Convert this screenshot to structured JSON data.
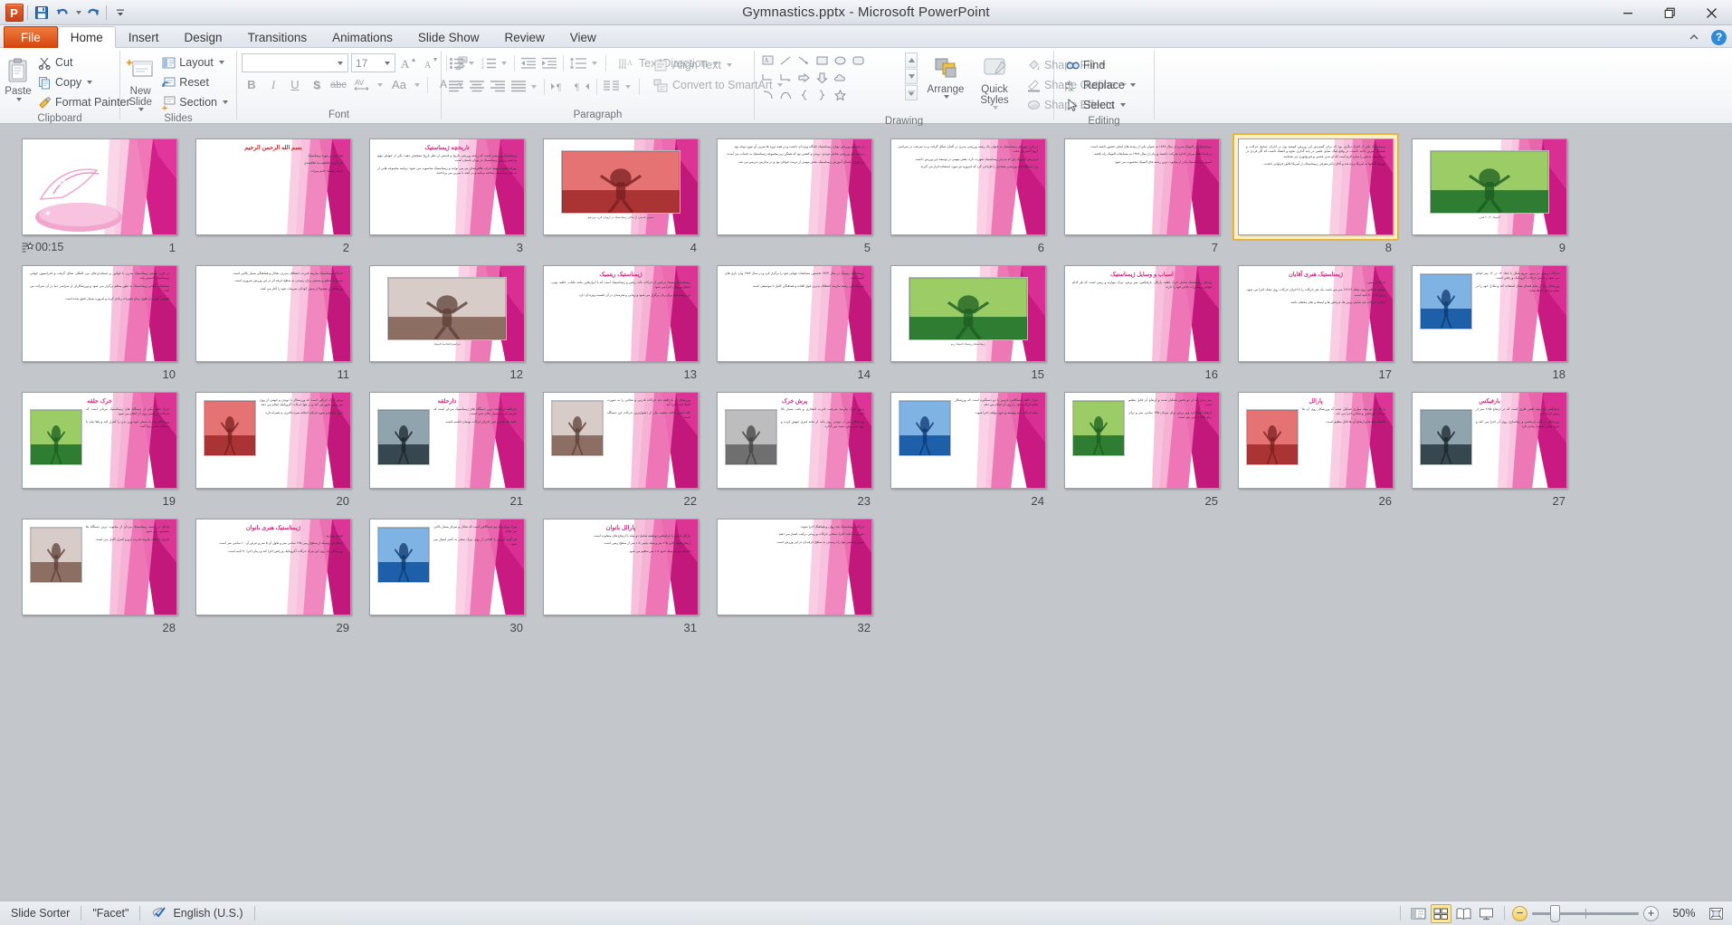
{
  "window": {
    "title": "Gymnastics.pptx  -  Microsoft PowerPoint",
    "minimize": "Minimize",
    "restore": "Restore Down",
    "close": "Close",
    "qat": [
      "save-icon",
      "undo-icon",
      "redo-icon",
      "customize-qat-icon"
    ]
  },
  "tabs": [
    {
      "label": "File",
      "kind": "file"
    },
    {
      "label": "Home",
      "kind": "active"
    },
    {
      "label": "Insert",
      "kind": "normal"
    },
    {
      "label": "Design",
      "kind": "normal"
    },
    {
      "label": "Transitions",
      "kind": "normal"
    },
    {
      "label": "Animations",
      "kind": "normal"
    },
    {
      "label": "Slide Show",
      "kind": "normal"
    },
    {
      "label": "Review",
      "kind": "normal"
    },
    {
      "label": "View",
      "kind": "normal"
    }
  ],
  "ribbon": {
    "clipboard": {
      "label": "Clipboard",
      "paste": "Paste",
      "cut": "Cut",
      "copy": "Copy",
      "format_painter": "Format Painter"
    },
    "slides": {
      "label": "Slides",
      "new_slide": "New Slide",
      "layout": "Layout",
      "reset": "Reset",
      "section": "Section"
    },
    "font": {
      "label": "Font",
      "font_name": "",
      "font_name_placeholder": "",
      "font_size": "17",
      "grow": "Increase Font Size",
      "shrink": "Decrease Font Size",
      "clear": "Clear All Formatting",
      "bold": "B",
      "italic": "I",
      "underline": "U",
      "shadow": "S",
      "strikethrough": "abc",
      "spacing": "AV",
      "change_case": "Aa",
      "font_color": "A"
    },
    "paragraph": {
      "label": "Paragraph",
      "bullets": "Bullets",
      "numbering": "Numbering",
      "decrease_indent": "Decrease List Level",
      "increase_indent": "Increase List Level",
      "line_spacing": "Line Spacing",
      "text_direction": "Text Direction",
      "align_text": "Align Text",
      "convert_smartart": "Convert to SmartArt",
      "align_left": "Align Text Left",
      "center": "Center",
      "align_right": "Align Text Right",
      "justify": "Justify",
      "ltr": "Left-to-Right",
      "rtl": "Right-to-Left",
      "columns": "Columns"
    },
    "drawing": {
      "label": "Drawing",
      "arrange": "Arrange",
      "quick_styles": "Quick Styles",
      "shape_fill": "Shape Fill",
      "shape_outline": "Shape Outline",
      "shape_effects": "Shape Effects"
    },
    "editing": {
      "label": "Editing",
      "find": "Find",
      "replace": "Replace",
      "select": "Select"
    }
  },
  "status": {
    "view_name": "Slide Sorter",
    "theme": "\"Facet\"",
    "language": "English (U.S.)",
    "zoom": "50%",
    "views": [
      {
        "name": "normal-view-button",
        "active": false
      },
      {
        "name": "slide-sorter-view-button",
        "active": true
      },
      {
        "name": "reading-view-button",
        "active": false
      },
      {
        "name": "slide-show-button",
        "active": false
      }
    ],
    "zoom_out": "−",
    "zoom_in": "+",
    "fit_window": "Fit slide to current window"
  },
  "slides": [
    {
      "n": "1",
      "timing": "00:15",
      "has_transition": true,
      "kind": "cover",
      "title": "",
      "paras": [],
      "caption": ""
    },
    {
      "n": "2",
      "kind": "text",
      "title": "بسم الله الرحمن الرحيم",
      "title_color": "red",
      "paras": [
        "چند خبر در مورد ژیمناستیک",
        "گرد آوری: فاطمه نیا علاقمندی",
        "استاد راهنما: خانم میراث"
      ],
      "caption": ""
    },
    {
      "n": "3",
      "kind": "text",
      "title": "تاریخچه ژیمناستیک",
      "paras": [
        "ژیمناستیک ورزشی است که رشته ورزشی تاریخ و قدمتی از نظر تاریخ تشخیص دهید. یکی از عوامل مهم پیدایش ورزش ژیمناستیک در یونان باستان است.",
        "روزانه هشت مهمه حرف ظاهرنشان نیز می توانند و ژیمناستیک محسوب می شود. برنامه مجموعه هایی از به نام ژیمناستیک ساخته برنامه و در آنچه با تمرین می پرداختند."
      ],
      "caption": ""
    },
    {
      "n": "4",
      "kind": "photo",
      "title": "",
      "paras": [],
      "caption": "تصویر قدیمی از سالن ژیمناستیک در اروپای قرن نوزدهم"
    },
    {
      "n": "5",
      "kind": "text2col",
      "paras": [
        "در سیستم ورزشی یونان ژیمناستیک جایگاه ویژه ای داشت و در همه دوره ها تمرین آن مورد توجه بود.",
        "برنامه های ورزشی شامل دویدن، پریدن و کشتی بود که همگی زیر مجموعه ژیمناستیک به حساب می آمدند.",
        "در دوران باستان آموزش ژیمناستیک بخش مهمی از تربیت جوانان بود و در مدارس تدریس می شد."
      ],
      "caption": ""
    },
    {
      "n": "6",
      "kind": "text2col",
      "paras": [
        "در قرن نوزدهم ژیمناستیک به عنوان یک رشته ورزشی مدرن در آلمان شکل گرفت و به سرعت در سراسر اروپا گسترش یافت.",
        "فردریش لودویگ یان که به پدر ژیمناستیک شهرت دارد، نقش مهمی در توسعه این ورزش داشت.",
        "وی دستگاه های ورزشی متعددی را طراحی کرد که امروزه نیز مورد استفاده قرار می گیرند."
      ],
      "caption": ""
    },
    {
      "n": "7",
      "kind": "text2col",
      "paras": [
        "ژیمناستیک در المپیک مدرن از سال ۱۸۹۶ به عنوان یکی از رشته های اصلی حضور داشته است.",
        "در ابتدا فقط مردان اجازه شرکت داشتند و زنان از سال ۱۹۲۸ به مسابقات المپیک راه یافتند.",
        "امروزه ژیمناستیک یکی از محبوب ترین رشته های المپیک محسوب می شود."
      ],
      "caption": ""
    },
    {
      "n": "8",
      "kind": "text2col",
      "selected": true,
      "paras": [
        "ژیمناستیک یکی از افراد دیگری بود که برای گسترش این ورزش کوشید وی بر اجرای صحیح حرکات و عملیات تمرین تاکید داشت. در واقع لینگ تمایل علمی در پایه گذاری نحوه و اعتقاد داشت که اگر فردی در ژیمناستیک بدنش را سازه لازم است که او بدنی عصبی و فیزیولوژی نیز بشناسد.",
        "توسط آلمانها به امریکا برده شد و آقای دکتر معرفی ژیمناستیک در آمریکا تلاش فراوانی داشت."
      ],
      "caption": ""
    },
    {
      "n": "9",
      "kind": "photo",
      "title": "",
      "paras": [],
      "caption": "المپیک ۲۰۱۲ لندن"
    },
    {
      "n": "10",
      "kind": "text2col",
      "paras": [
        "در قرن بیستم ژیمناستیک مدرن با قوانین و استانداردهای بین المللی شکل گرفت و فدراسیون جهانی ژیمناستیک تاسیس شد.",
        "مسابقات جهانی ژیمناستیک به طور منظم برگزار می شود و ورزشکاران از سراسر دنیا در آن شرکت می کنند.",
        "قوانین داوری در طول زمان تغییرات زیادی کرده و امروزه بسیار دقیق شده است."
      ],
      "caption": ""
    },
    {
      "n": "11",
      "kind": "text2col",
      "paras": [
        "حرکات ژیمناستیک نیازمند قدرت، انعطاف پذیری، تعادل و هماهنگی بسیار بالایی است.",
        "تمرینات منظم و مستمر برای رسیدن به سطح حرفه ای در این ورزش ضروری است.",
        "ورزشکاران معمولا از سنین کودکی تمرینات خود را آغاز می کنند."
      ],
      "caption": ""
    },
    {
      "n": "12",
      "kind": "photo",
      "title": "",
      "paras": [],
      "caption": "مراسم افتتاحیه المپیک"
    },
    {
      "n": "13",
      "kind": "text2col",
      "title": "ژیمناستیک ریتمیک",
      "paras": [
        "ژیمناستیک ریتمیک ترکیبی از حرکات باله، رقص و ژیمناستیک است که با ابزارهایی مانند طناب، حلقه، توپ، چماق و روبان اجرا می شود.",
        "این رشته تنها برای زنان برگزار می شود و زیبایی و هنرمندی در آن اهمیت ویژه ای دارد."
      ],
      "caption": ""
    },
    {
      "n": "14",
      "kind": "text2col",
      "paras": [
        "ژیمناستیک ریتمیک در سال ۱۹۶۳ نخستین مسابقات جهانی خود را برگزار کرد و در سال ۱۹۸۴ وارد بازی های المپیک شد.",
        "تمرینات این رشته نیازمند انعطاف پذیری فوق العاده و هماهنگی کامل با موسیقی است."
      ],
      "caption": ""
    },
    {
      "n": "15",
      "kind": "photo",
      "title": "",
      "paras": [],
      "caption": "ژیمناستیک ریتمیک المپیک ریو"
    },
    {
      "n": "16",
      "kind": "text",
      "title": "اسباب و وسایل ژیمناستیک",
      "paras": [
        "وسایل ژیمناستیک شامل خرک حلقه، پارالل، بارفیکس، میز پرش، تیرک موازنه و زمین است که هر کدام قوانین و مقررات خاص خود را دارند."
      ],
      "caption": ""
    },
    {
      "n": "17",
      "kind": "text",
      "title": "ژیمناستیک هنری آقایان",
      "paras": [
        "حرکات زمینی",
        "شامل حرکاتی روی تشک ۱۲×۱۲ متر می باشد، یک نفر حرکات را تا اجرای حرکات روی تشک اجرا می شود. زمان اجرا ۷۰ ثانیه است.",
        "ترکیب حرکات باید شامل پرش ها، چرخش ها و ایستادن های مختلف باشد."
      ],
      "caption": ""
    },
    {
      "n": "18",
      "kind": "textimg",
      "paras": [
        "حرکات زمینی در زمین مربع شکل با ابعاد ۱۲ در ۱۲ متر انجام می شود و شامل حرکات آکروباتیک و رقص است.",
        "ورزشکار باید از تمام فضای تشک استفاده کند و تعادل خود را در تمام مراحل حفظ نماید."
      ],
      "caption": ""
    },
    {
      "n": "19",
      "kind": "textimg",
      "title": "خرک حلقه",
      "paras": [
        "خرک حلقه یکی از دستگاه های ژیمناستیک مردان است که حرکات چرخشی روی آن انجام می شود.",
        "ورزشکار باید با دستان خود وزن بدن را کنترل کند و پاها نباید با دستگاه تماس پیدا کنند."
      ],
      "caption": ""
    },
    {
      "n": "20",
      "kind": "textimg",
      "paras": [
        "پرش خرک حرکتی است که ورزشکار با دویدن و جهش از روی میز پرش عبور می کند و در هوا حرکات آکروباتیک انجام می دهد.",
        "فرود صحیح و بدون حرکت اضافه نمره بالاتری به همراه دارد."
      ],
      "caption": ""
    },
    {
      "n": "21",
      "kind": "textimg",
      "title": "دارحلقه",
      "paras": [
        "دارحلقه از سخت ترین دستگاه های ژیمناستیک مردان است که نیازمند قدرت بسیار بالای بدنی است.",
        "حلقه ها نباید در حین اجرای حرکات نوسان داشته باشند."
      ],
      "caption": ""
    },
    {
      "n": "22",
      "kind": "textimg",
      "paras": [
        "ورزشکار در دارحلقه باید حرکات قدرتی و تعادلی را به صورت کاملا ثابت اجرا کند.",
        "نگه داشتن حالت صلیب یکی از دشوارترین حرکات این دستگاه است."
      ],
      "caption": ""
    },
    {
      "n": "23",
      "kind": "textimg",
      "title": "پرش خرک",
      "paras": [
        "پرش خرک نیازمند سرعت، قدرت انفجاری و دقت بسیار بالا است.",
        "ورزشکار پس از دویدن روی باند، از تخته فنری جهش کرده و روی میز پرش دست می گذارد."
      ],
      "caption": ""
    },
    {
      "n": "24",
      "kind": "textimg",
      "paras": [
        "خرک حلقه دستگاهی چرمی با دو دستگیره است که ورزشکار تمام حرکات خود را روی آن انجام می دهد.",
        "تمام حرکات باید پیوسته و بدون توقف اجرا شوند."
      ],
      "caption": ""
    },
    {
      "n": "25",
      "kind": "textimg",
      "paras": [
        "میز پرش که از دو بخش تشکیل شده و ارتفاع آن قابل تنظیم است.",
        "ارتفاع استاندارد میز پرش برای مردان ۱۳۵ سانتی متر و برای زنان ۱۲۵ سانتی متر است."
      ],
      "caption": ""
    },
    {
      "n": "26",
      "kind": "textimg",
      "title": "پارالل",
      "paras": [
        "پارالل از دو میله موازی تشکیل شده که ورزشکار روی آن ها حرکات چرخشی و تعادلی اجرا می کند.",
        "فاصله میله ها و ارتفاع آن ها قابل تنظیم است."
      ],
      "caption": ""
    },
    {
      "n": "27",
      "kind": "textimg",
      "title": "بارفیکس",
      "paras": [
        "بارفیکس یک میله افقی فلزی است که در ارتفاع ۲.۷۵ متر از زمین قرار دارد.",
        "ورزشکار حرکات چرخشی و رهاسازی روی آن اجرا می کند و فرود نهایی اهمیت زیادی دارد."
      ],
      "caption": ""
    },
    {
      "n": "28",
      "kind": "textimg",
      "paras": [
        "پارالل در رشته ژیمناستیک مردان از محبوب ترین دستگاه ها محسوب می شود.",
        "اجرای حرکات نیازمند قدرت بازو و کنترل کامل بدن است."
      ],
      "caption": ""
    },
    {
      "n": "29",
      "kind": "text",
      "title": "ژیمناستیک هنری بانوان",
      "paras": [
        "جدول موازنه",
        "ارتفاع این وسیله از سطح زمین ۱۲۵ سانتی متر و طول آن ۵ متر و عرض آن ۱۰ سانتی متر است.",
        "ورزشکار باید روی این تیرک حرکات آکروباتیک و رقص اجرا کند و زمان اجرا ۹۰ ثانیه است."
      ],
      "caption": ""
    },
    {
      "n": "30",
      "kind": "textimg",
      "paras": [
        "تیرک موازنه یا بیم دستگاهی است که تعادل و تمرکز بسیار بالایی می طلبد.",
        "هر گونه لرزش یا افتادن از روی تیرک منجر به کسر امتیاز می شود."
      ],
      "caption": ""
    },
    {
      "n": "31",
      "kind": "text",
      "title": "پارالل بانوان",
      "paras": [
        "پارالل نابرابر یا بارفیکس دوطبقه شامل دو میله با ارتفاع های متفاوت است.",
        "ارتفاع میله بالایی ۲.۵ متر و میله پایینی ۱.۷ متر از سطح زمین است.",
        "فاصله بین دو میله حدود ۱.۸ متر تنظیم می شود."
      ],
      "caption": ""
    },
    {
      "n": "32",
      "kind": "text",
      "paras": [
        "حرکات ژیمناستیک باید روان و هماهنگ اجرا شوند.",
        "داوران به دقت اجرا، سختی حرکات و زیبایی ترکیب امتیاز می دهند.",
        "تمرین مستمر تنها راه رسیدن به سطح حرفه ای در این ورزش است."
      ],
      "caption": ""
    }
  ]
}
